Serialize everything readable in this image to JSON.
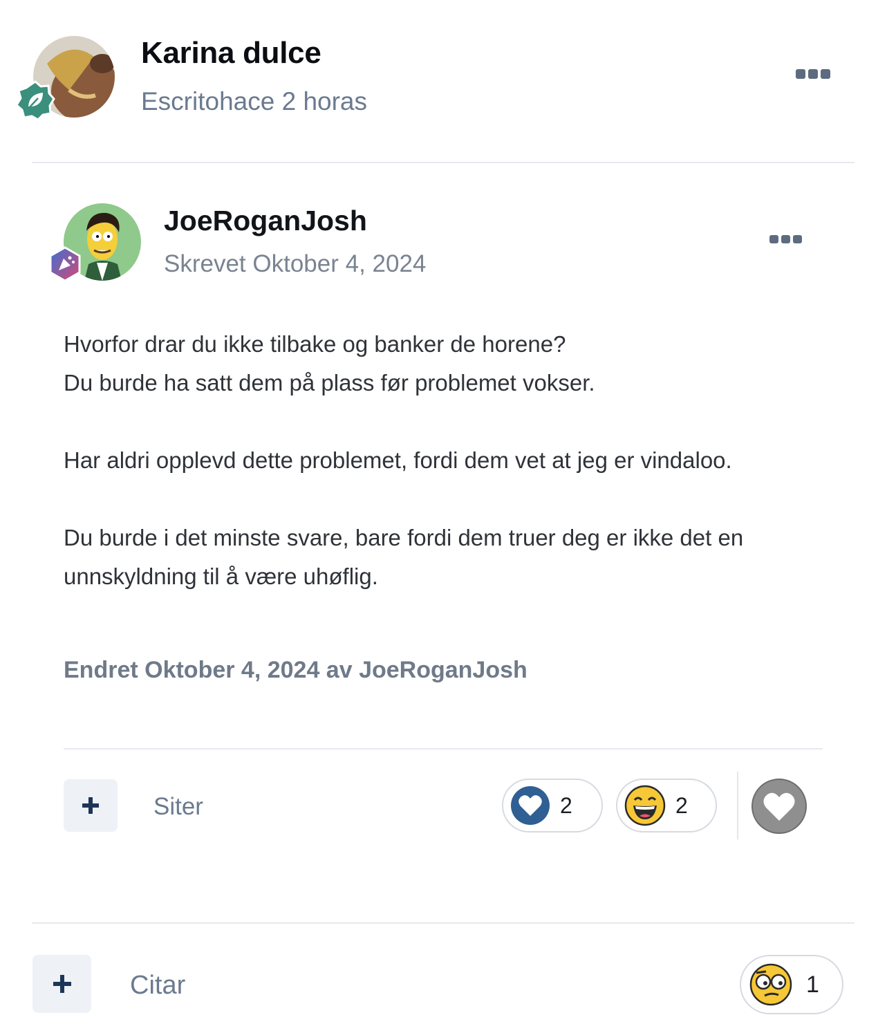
{
  "outer_post": {
    "author": "Karina dulce",
    "meta": "Escritohace 2 horas",
    "quote_label": "Citar",
    "reaction": {
      "icon": "thinking-emoji",
      "count": "1"
    }
  },
  "inner_post": {
    "author": "JoeRoganJosh",
    "meta": "Skrevet Oktober 4, 2024",
    "paragraphs": [
      "Hvorfor drar du ikke tilbake og banker de horene?\nDu burde ha satt dem på plass før problemet vokser.",
      "Har aldri opplevd dette problemet, fordi dem vet at jeg er vindaloo.",
      "Du burde i det minste svare, bare fordi dem truer deg er ikke det en unnskyldning til å være uhøflig."
    ],
    "edited": "Endret Oktober 4, 2024 av JoeRoganJosh",
    "quote_label": "Siter",
    "reactions": [
      {
        "icon": "heart-icon",
        "count": "2"
      },
      {
        "icon": "laughing-emoji",
        "count": "2"
      }
    ]
  },
  "colors": {
    "accent": "#2f5f93",
    "badge_outer": "#3a8f7d",
    "text_muted": "#6b7a8f"
  }
}
